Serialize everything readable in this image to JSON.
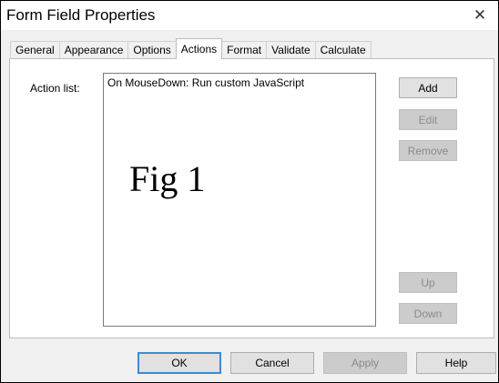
{
  "window": {
    "title": "Form Field Properties",
    "close_glyph": "✕"
  },
  "tabs": [
    {
      "label": "General",
      "active": false
    },
    {
      "label": "Appearance",
      "active": false
    },
    {
      "label": "Options",
      "active": false
    },
    {
      "label": "Actions",
      "active": true
    },
    {
      "label": "Format",
      "active": false
    },
    {
      "label": "Validate",
      "active": false
    },
    {
      "label": "Calculate",
      "active": false
    }
  ],
  "actions": {
    "list_label": "Action list:",
    "items": [
      "On MouseDown: Run custom JavaScript"
    ],
    "annotation": "Fig 1"
  },
  "side_buttons": {
    "add": "Add",
    "edit": "Edit",
    "remove": "Remove",
    "up": "Up",
    "down": "Down"
  },
  "footer_buttons": {
    "ok": "OK",
    "cancel": "Cancel",
    "apply": "Apply",
    "help": "Help"
  },
  "colors": {
    "default_button_border": "#3c8bd6",
    "disabled_text": "#8a8a8a"
  }
}
